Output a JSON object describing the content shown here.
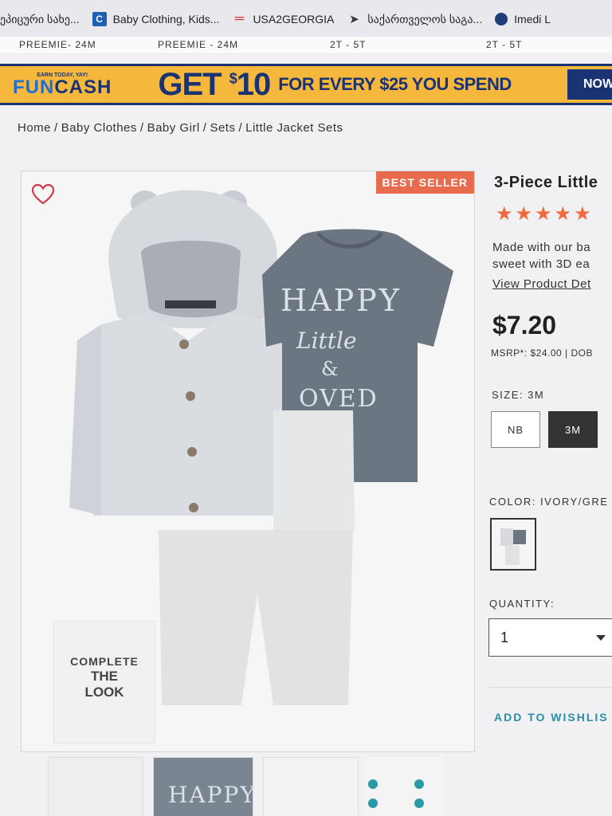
{
  "bookmarks": [
    {
      "label": "ეპიცური სახე...",
      "icon": "page-icon"
    },
    {
      "label": "Baby Clothing, Kids...",
      "icon": "carters-c-icon"
    },
    {
      "label": "USA2GEORGIA",
      "icon": "usa2georgia-icon"
    },
    {
      "label": "საქართველოს საგა...",
      "icon": "arrow-logo-icon"
    },
    {
      "label": "Imedi L",
      "icon": "imedi-icon"
    }
  ],
  "size_strip": [
    "PREEMIE- 24M",
    "PREEMIE - 24M",
    "2T - 5T",
    "2T - 5T"
  ],
  "promo": {
    "earn_today": "EARN TODAY, YAY!",
    "fun": "FUN",
    "cash": "CASH",
    "get": "GET",
    "dollar_sign": "$",
    "amount": "10",
    "rest": "FOR EVERY $25 YOU SPEND",
    "now_button": "NOW",
    "colors": {
      "background": "#f6b83c",
      "navy": "#1a3372",
      "blue": "#1d6ed0"
    }
  },
  "breadcrumb": [
    "Home",
    "/",
    "Baby Clothes",
    "/",
    "Baby Girl",
    "/",
    "Sets",
    "/",
    "Little Jacket Sets"
  ],
  "product": {
    "badge": "BEST SELLER",
    "title": "3-Piece Little",
    "rating_stars": "★★★★★",
    "description_lines": [
      "Made with our ba",
      "sweet with 3D ea"
    ],
    "view_details": "View Product Det",
    "price": "$7.20",
    "msrp": "MSRP*: $24.00 | DOB",
    "size_label": "SIZE: 3M",
    "sizes": [
      "NB",
      "3M"
    ],
    "selected_size": "3M",
    "color_label": "COLOR: IVORY/GRE",
    "quantity_label": "QUANTITY:",
    "quantity_value": "1",
    "add_to_wishlist": "ADD TO WISHLIS",
    "tee_print": {
      "line1": "HAPPY",
      "line2": "Little",
      "line3": "&",
      "line4": "OVED"
    },
    "complete_look": {
      "line1": "COMPLETE",
      "line2": "THE",
      "line3": "LOOK"
    },
    "thumb_print": "HAPPY",
    "colors": {
      "badge": "#e86b4d",
      "stars": "#f06a3b",
      "wishlist": "#2a8fa6"
    }
  }
}
